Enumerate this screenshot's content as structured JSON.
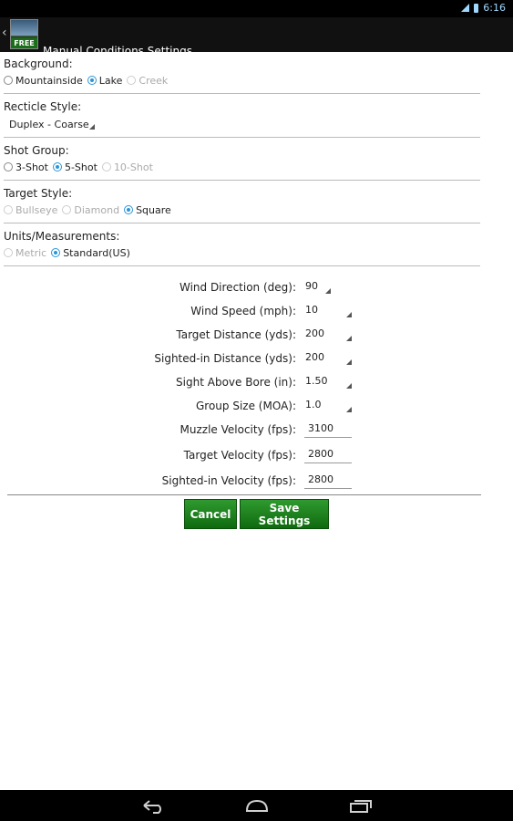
{
  "status": {
    "time": "6:16"
  },
  "app": {
    "title": "Manual Conditions Settings",
    "badge": "FREE"
  },
  "background": {
    "label": "Background:",
    "options": [
      {
        "label": "Mountainside",
        "selected": false,
        "enabled": true
      },
      {
        "label": "Lake",
        "selected": true,
        "enabled": true
      },
      {
        "label": "Creek",
        "selected": false,
        "enabled": false
      }
    ]
  },
  "reticle": {
    "label": "Recticle Style:",
    "value": "Duplex - Coarse"
  },
  "shot_group": {
    "label": "Shot Group:",
    "options": [
      {
        "label": "3-Shot",
        "selected": false,
        "enabled": true
      },
      {
        "label": "5-Shot",
        "selected": true,
        "enabled": true
      },
      {
        "label": "10-Shot",
        "selected": false,
        "enabled": false
      }
    ]
  },
  "target_style": {
    "label": "Target Style:",
    "options": [
      {
        "label": "Bullseye",
        "selected": false,
        "enabled": false
      },
      {
        "label": "Diamond",
        "selected": false,
        "enabled": false
      },
      {
        "label": "Square",
        "selected": true,
        "enabled": true
      }
    ]
  },
  "units": {
    "label": "Units/Measurements:",
    "options": [
      {
        "label": "Metric",
        "selected": false,
        "enabled": false
      },
      {
        "label": "Standard(US)",
        "selected": true,
        "enabled": true
      }
    ]
  },
  "fields": [
    {
      "label": "Wind Direction (deg):",
      "value": "90",
      "type": "select"
    },
    {
      "label": "Wind Speed (mph):",
      "value": "10",
      "type": "select"
    },
    {
      "label": "Target Distance (yds):",
      "value": "200",
      "type": "select"
    },
    {
      "label": "Sighted-in Distance (yds):",
      "value": "200",
      "type": "select"
    },
    {
      "label": "Sight Above Bore (in):",
      "value": "1.50",
      "type": "select"
    },
    {
      "label": "Group Size (MOA):",
      "value": "1.0",
      "type": "select"
    },
    {
      "label": "Muzzle Velocity (fps):",
      "value": "3100",
      "type": "input"
    },
    {
      "label": "Target Velocity (fps):",
      "value": "2800",
      "type": "input"
    },
    {
      "label": "Sighted-in Velocity (fps):",
      "value": "2800",
      "type": "input"
    }
  ],
  "buttons": {
    "cancel": "Cancel",
    "save": "Save Settings"
  },
  "colors": {
    "accent": "#2b95d6",
    "button_green": "#0f6a0f"
  },
  "nav": {
    "back": "back-icon",
    "home": "home-icon",
    "recents": "recents-icon"
  }
}
